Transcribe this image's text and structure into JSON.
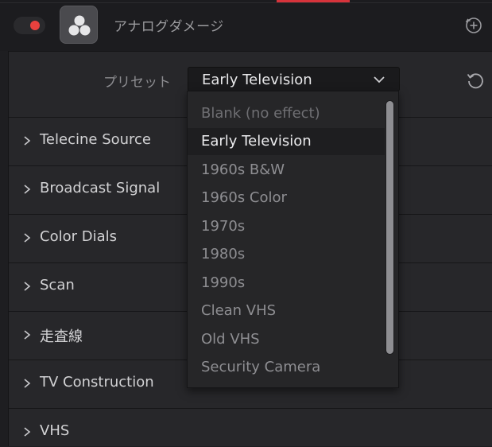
{
  "header": {
    "title": "アナログダメージ",
    "toggle_on": true,
    "toggle_color": "#e8413e"
  },
  "icons": {
    "toggle": "toggle-switch",
    "effect": "resolve-fx-icon",
    "add": "add-keyframe-icon",
    "reset": "reset-icon",
    "chevron": "chevron-down-icon",
    "expand": "chevron-right-icon"
  },
  "preset": {
    "label": "プリセット",
    "selected": "Early Television",
    "options": [
      "Blank (no effect)",
      "Early Television",
      "1960s B&W",
      "1960s Color",
      "1970s",
      "1980s",
      "1990s",
      "Clean VHS",
      "Old VHS",
      "Security Camera"
    ]
  },
  "sections": [
    "Telecine Source",
    "Broadcast Signal",
    "Color Dials",
    "Scan",
    "走査線",
    "TV Construction",
    "VHS"
  ],
  "colors": {
    "accent_red": "#d6333b",
    "panel_bg": "#27272a",
    "menu_bg": "#262628"
  }
}
